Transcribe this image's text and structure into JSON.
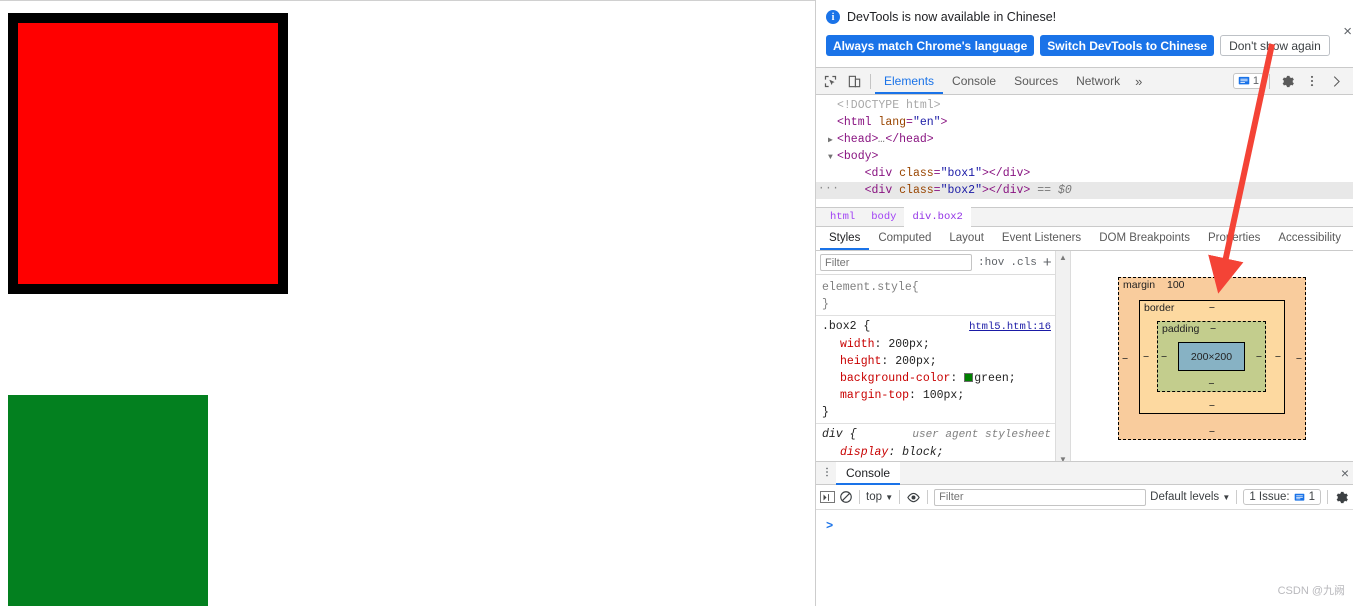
{
  "page": {
    "box1": {
      "name": "red-box",
      "color": "#ff0000",
      "border_color": "#000000"
    },
    "box2": {
      "name": "green-box",
      "color": "#03801f"
    }
  },
  "infobar": {
    "icon": "info-icon",
    "message": "DevTools is now available in Chinese!",
    "buttons": {
      "always_match": "Always match Chrome's language",
      "switch": "Switch DevTools to Chinese",
      "dont_show": "Don't show again"
    },
    "close": "×"
  },
  "toolbar": {
    "inspect_icon": "inspect-element-icon",
    "device_icon": "device-toolbar-icon",
    "tabs": [
      {
        "label": "Elements",
        "active": true
      },
      {
        "label": "Console",
        "active": false
      },
      {
        "label": "Sources",
        "active": false
      },
      {
        "label": "Network",
        "active": false
      }
    ],
    "more_tabs": "»",
    "message_icon": "message-badge-icon",
    "message_count": "1",
    "settings_icon": "gear-icon",
    "menu_icon": "kebab-menu-icon",
    "close_icon": "close-devtools-icon"
  },
  "dom": {
    "lines": [
      {
        "id": "doctype",
        "text": "<!DOCTYPE html>"
      },
      {
        "id": "html",
        "text": "<html lang=\"en\">"
      },
      {
        "id": "head",
        "text": "<head>…</head>",
        "triangle": "▶"
      },
      {
        "id": "body",
        "text": "<body>",
        "triangle": "▼"
      },
      {
        "id": "box1",
        "text": "<div class=\"box1\"></div>"
      },
      {
        "id": "box2",
        "text": "<div class=\"box2\"></div> == $0",
        "selected": true
      }
    ],
    "doctype_text": "<!DOCTYPE html>",
    "html_tag": "html",
    "html_attr": "lang",
    "html_val": "\"en\"",
    "head_tag": "head",
    "body_tag": "body",
    "div_tag": "div",
    "class_attr": "class",
    "box1_val": "\"box1\"",
    "box2_val": "\"box2\"",
    "selected_marker": "== $0",
    "ellipsis_dots": "…"
  },
  "breadcrumb": {
    "items": [
      {
        "label": "html",
        "active": false
      },
      {
        "label": "body",
        "active": false
      },
      {
        "label": "div.box2",
        "active": true
      }
    ]
  },
  "sidebar_tabs": [
    {
      "label": "Styles",
      "active": true
    },
    {
      "label": "Computed",
      "active": false
    },
    {
      "label": "Layout",
      "active": false
    },
    {
      "label": "Event Listeners",
      "active": false
    },
    {
      "label": "DOM Breakpoints",
      "active": false
    },
    {
      "label": "Properties",
      "active": false
    },
    {
      "label": "Accessibility",
      "active": false
    }
  ],
  "styles": {
    "filter_placeholder": "Filter",
    "filter_value": "",
    "hov": ":hov",
    "cls": ".cls",
    "new_rule": "+",
    "toggle_pane": "▶|",
    "rules": [
      {
        "selector": "element.style",
        "origin": "",
        "origin_type": "none",
        "properties": []
      },
      {
        "selector": ".box2",
        "origin": "html5.html:16",
        "origin_type": "link",
        "properties": [
          {
            "name": "width",
            "value": "200px",
            "swatch": null
          },
          {
            "name": "height",
            "value": "200px",
            "swatch": null
          },
          {
            "name": "background-color",
            "value": "green",
            "swatch": "#008000"
          },
          {
            "name": "margin-top",
            "value": "100px",
            "swatch": null
          }
        ]
      },
      {
        "selector": "div",
        "origin": "user agent stylesheet",
        "origin_type": "ua",
        "properties": [
          {
            "name": "display",
            "value": "block",
            "swatch": null
          }
        ]
      }
    ],
    "open_brace": "{",
    "close_brace": "}",
    "colon": ":",
    "semicolon": ";"
  },
  "box_model": {
    "margin_label": "margin",
    "margin_top": "100",
    "margin_right": "−",
    "margin_bottom": "−",
    "margin_left": "−",
    "border_label": "border",
    "border_top": "−",
    "border_right": "−",
    "border_bottom": "−",
    "border_left": "−",
    "padding_label": "padding",
    "padding_top": "−",
    "padding_right": "−",
    "padding_bottom": "−",
    "padding_left": "−",
    "content_size": "200×200",
    "colors": {
      "margin": "#f9cc9d",
      "border": "#fdd9a0",
      "padding": "#c3cd8d",
      "content": "#87b2c4"
    }
  },
  "drawer": {
    "menu_icon": "kebab-menu-icon",
    "tab_label": "Console",
    "close": "×",
    "console_toolbar": {
      "sidebar_icon": "console-sidebar-icon",
      "clear_icon": "clear-console-icon",
      "context": "top",
      "context_caret": "▼",
      "eye_icon": "live-expression-icon",
      "filter_placeholder": "Filter",
      "filter_value": "",
      "levels": "Default levels",
      "levels_caret": "▼",
      "issues_label": "1 Issue:",
      "issues_icon": "issue-message-icon",
      "issues_count": "1",
      "settings_icon": "console-settings-icon"
    },
    "prompt": ">"
  },
  "annotation": {
    "arrow_color": "#f44336",
    "name": "red-annotation-arrow"
  },
  "watermark": "CSDN @九阙"
}
